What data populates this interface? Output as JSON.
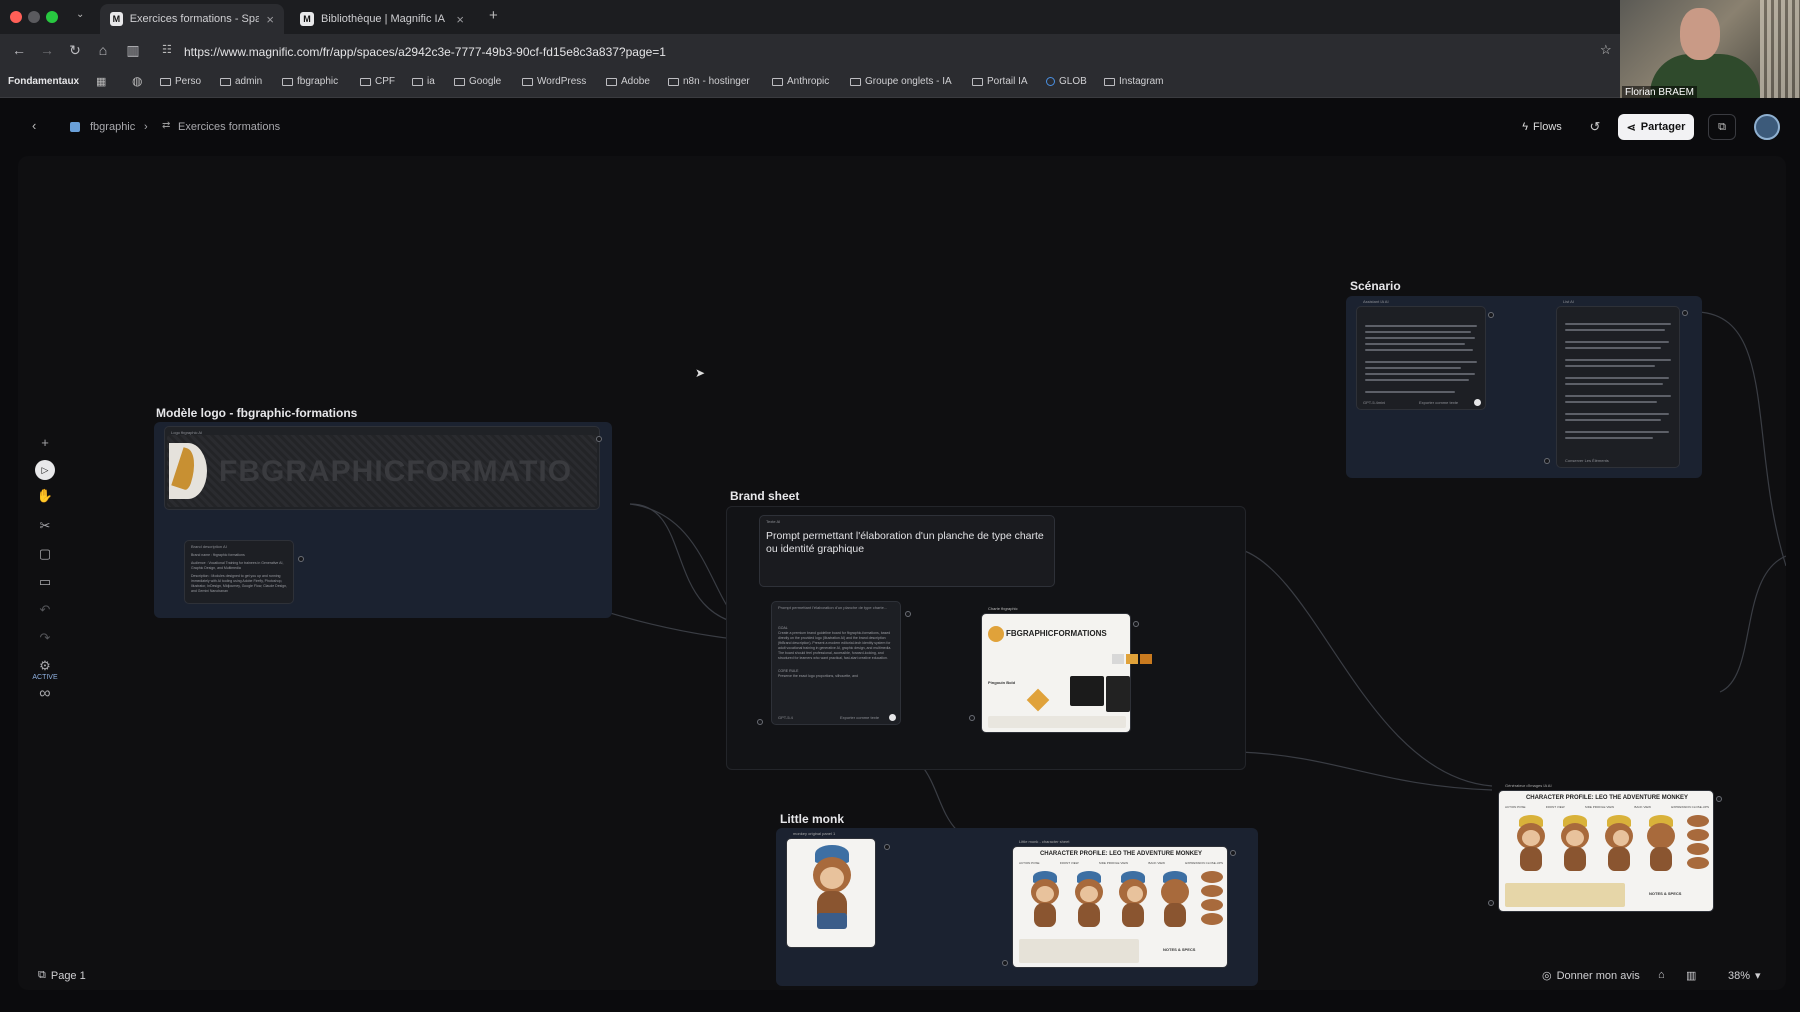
{
  "browser": {
    "tabs": [
      {
        "label": "Exercices formations - Space",
        "active": true
      },
      {
        "label": "Bibliothèque | Magnific IA",
        "active": false
      }
    ],
    "url": "https://www.magnific.com/fr/app/spaces/a2942c3e-7777-49b3-90cf-fd15e8c3a837?page=1",
    "bookmarks": [
      "Fondamentaux",
      "Perso",
      "admin",
      "fbgraphic",
      "CPF",
      "ia",
      "Google",
      "WordPress",
      "Adobe",
      "n8n - hostinger",
      "Anthropic",
      "Groupe onglets - IA",
      "Portail IA",
      "GLOB",
      "Instagram"
    ]
  },
  "webcam": {
    "name": "Florian BRAEM"
  },
  "header": {
    "breadcrumb": {
      "space": "fbgraphic",
      "page": "Exercices formations"
    },
    "flows_label": "Flows",
    "share_label": "Partager"
  },
  "toolbar": {
    "active_label": "ACTIVE"
  },
  "groups": {
    "logo": {
      "title": "Modèle logo - fbgraphic-formations",
      "logo_text": "FBGRAPHICFORMATIO",
      "node_logo_title": "Logo fbgraphic AI",
      "node_desc_title": "Brand description AI",
      "desc_lines": [
        "Brand name : fbgraphic formations",
        "Audience : Vocational Training for trainees in Generative AI, Graphic Design, and Multimedia",
        "Description : Modules designed to get you up and running immediately with AI tooling using Adobe Firefly, Photoshop, Illustrator, InDesign, Midjourney, Google Flow, Claude Design, and Gemini Nanobanan"
      ]
    },
    "brand": {
      "title": "Brand sheet",
      "text_node_title": "Texte AI",
      "prompt_text": "Prompt permettant l'élaboration d'un planche de type charte ou identité graphique",
      "gen_node_title": "Prompt permettant l'élaboration d'un planche de type charte...",
      "gen_lines": [
        "GOAL",
        "Create a premium brand guideline board for fbgraphic-formations, based directly on the provided logo (Illustration AI) and the brand description (fbBrand description). Present a modern editorial-tech identity system for adult vocational training in generative AI, graphic design, and multimedia. The board should feel professional, accessible, forward-looking, and structured for learners who want practical, fast-start creative education.",
        "CORE RULE",
        "Preserve the exact logo proportions, silhouette, and"
      ],
      "gen_footer": "GPT-5.4",
      "gen_action": "Exporter comme texte",
      "sheet_node_title": "Charte fbgraphic",
      "sheet_logo": "FBGRAPHICFORMATIONS",
      "sheet_label": "Pingouin Bold",
      "palette": [
        "#d8d8d8",
        "#e0a23a",
        "#c97a1f",
        "#111111",
        "#1b1b1b"
      ]
    },
    "scenario": {
      "title": "Scénario",
      "node1_title": "Assistant IA AI",
      "node2_title": "List AI",
      "node1_footer": "GPT-5.4mini",
      "node1_action": "Exporter comme texte",
      "node2_action": "Conserver Les Éléments"
    },
    "monk": {
      "title": "Little monk",
      "node1_title": "monkey original panel 1",
      "node2_title": "Little monk - character sheet",
      "sheet_title": "CHARACTER PROFILE: LEO THE ADVENTURE MONKEY",
      "poses": [
        "ACTION POSE",
        "FRONT VIEW",
        "SIDE PROFILE VIEW",
        "BACK VIEW",
        "EXPRESSION CLOSE-UPS"
      ],
      "notes": "NOTES & SPECS"
    },
    "outside": {
      "node_title": "Générateur d'images IA AI",
      "sheet_title": "CHARACTER PROFILE: LEO THE ADVENTURE MONKEY",
      "poses": [
        "ACTION POSE",
        "FRONT VIEW",
        "SIDE PROFILE VIEW",
        "BACK VIEW",
        "EXPRESSION CLOSE-UPS"
      ],
      "notes": "NOTES & SPECS"
    }
  },
  "bottom": {
    "page_label": "Page 1",
    "feedback_label": "Donner mon avis",
    "zoom": "38%"
  }
}
